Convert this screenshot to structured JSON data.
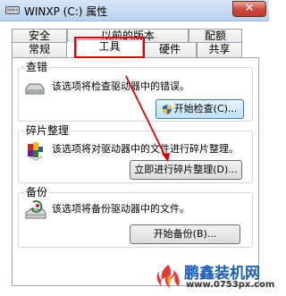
{
  "window": {
    "title": "WINXP (C:) 属性",
    "close_symbol": "✕"
  },
  "tabs_row1": [
    {
      "label": "安全"
    },
    {
      "label": "以前的版本"
    },
    {
      "label": "配额"
    }
  ],
  "tabs_row2": [
    {
      "label": "常规"
    },
    {
      "label": "工具",
      "selected": true
    },
    {
      "label": "硬件"
    },
    {
      "label": "共享"
    }
  ],
  "error_check": {
    "heading": "查错",
    "description": "该选项将检查驱动器中的错误。",
    "button_label": "开始检查(C)..."
  },
  "defrag": {
    "heading": "碎片整理",
    "description": "该选项将对驱动器中的文件进行碎片整理。",
    "button_label": "立即进行碎片整理(D)..."
  },
  "backup": {
    "heading": "备份",
    "description": "该选项将备份驱动器中的文件。",
    "button_label": "开始备份(B)..."
  },
  "watermark": {
    "title": "鹏鑫装机网",
    "url": "www.0753px.com"
  },
  "colors": {
    "highlight_box": "#e00000",
    "annotation_arrow": "#e00000",
    "watermark_blue": "#1a5fb4"
  },
  "icons": [
    "drive-icon",
    "defrag-icon",
    "backup-icon",
    "shield-icon",
    "window-icon"
  ]
}
